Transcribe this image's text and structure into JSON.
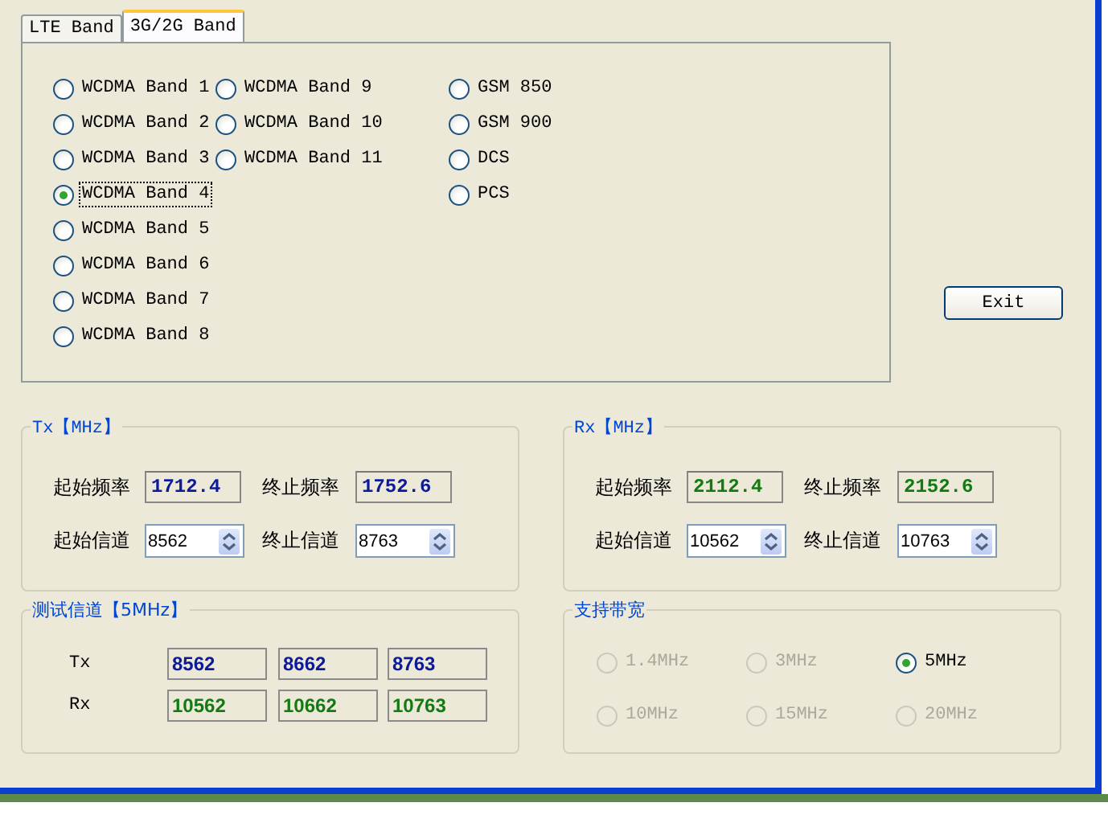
{
  "tabs": [
    {
      "label": "LTE Band",
      "selected": false
    },
    {
      "label": "3G/2G Band",
      "selected": true
    }
  ],
  "band_columns": [
    [
      {
        "label": "WCDMA Band 1",
        "selected": false
      },
      {
        "label": "WCDMA Band 2",
        "selected": false
      },
      {
        "label": "WCDMA Band 3",
        "selected": false
      },
      {
        "label": "WCDMA Band 4",
        "selected": true
      },
      {
        "label": "WCDMA Band 5",
        "selected": false
      },
      {
        "label": "WCDMA Band 6",
        "selected": false
      },
      {
        "label": "WCDMA Band 7",
        "selected": false
      },
      {
        "label": "WCDMA Band 8",
        "selected": false
      }
    ],
    [
      {
        "label": "WCDMA Band 9",
        "selected": false
      },
      {
        "label": "WCDMA Band 10",
        "selected": false
      },
      {
        "label": "WCDMA Band 11",
        "selected": false
      }
    ],
    [
      {
        "label": "GSM 850",
        "selected": false
      },
      {
        "label": "GSM 900",
        "selected": false
      },
      {
        "label": "DCS",
        "selected": false
      },
      {
        "label": "PCS",
        "selected": false
      }
    ]
  ],
  "exit_button": "Exit",
  "frequency_groups": [
    {
      "title": "Tx【MHz】",
      "color": "#0c1a9a",
      "fields": [
        {
          "label": "起始频率",
          "value": "1712.4",
          "kind": "readout"
        },
        {
          "label": "终止频率",
          "value": "1752.6",
          "kind": "readout"
        },
        {
          "label": "起始信道",
          "value": "8562",
          "kind": "spin"
        },
        {
          "label": "终止信道",
          "value": "8763",
          "kind": "spin"
        }
      ]
    },
    {
      "title": "Rx【MHz】",
      "color": "#137a13",
      "fields": [
        {
          "label": "起始频率",
          "value": "2112.4",
          "kind": "readout"
        },
        {
          "label": "终止频率",
          "value": "2152.6",
          "kind": "readout"
        },
        {
          "label": "起始信道",
          "value": "10562",
          "kind": "spin"
        },
        {
          "label": "终止信道",
          "value": "10763",
          "kind": "spin"
        }
      ]
    }
  ],
  "test_channels": {
    "title": "测试信道【5MHz】",
    "rows": [
      {
        "label": "Tx",
        "color": "#0c1a9a",
        "values": [
          "8562",
          "8662",
          "8763"
        ]
      },
      {
        "label": "Rx",
        "color": "#137a13",
        "values": [
          "10562",
          "10662",
          "10763"
        ]
      }
    ]
  },
  "bandwidth": {
    "title": "支持带宽",
    "options": [
      {
        "label": "1.4MHz",
        "selected": false,
        "disabled": true
      },
      {
        "label": "3MHz",
        "selected": false,
        "disabled": true
      },
      {
        "label": "5MHz",
        "selected": true,
        "disabled": false
      },
      {
        "label": "10MHz",
        "selected": false,
        "disabled": true
      },
      {
        "label": "15MHz",
        "selected": false,
        "disabled": true
      },
      {
        "label": "20MHz",
        "selected": false,
        "disabled": true
      }
    ]
  }
}
